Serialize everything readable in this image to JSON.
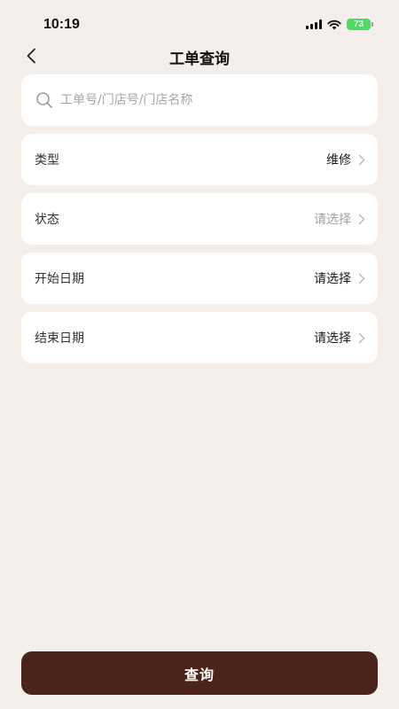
{
  "status_bar": {
    "time": "10:19",
    "battery": "73"
  },
  "header": {
    "title": "工单查询"
  },
  "search": {
    "placeholder": "工单号/门店号/门店名称"
  },
  "fields": [
    {
      "label": "类型",
      "value": "维修",
      "muted": false
    },
    {
      "label": "状态",
      "value": "请选择",
      "muted": true
    },
    {
      "label": "开始日期",
      "value": "请选择",
      "muted": false
    },
    {
      "label": "结束日期",
      "value": "请选择",
      "muted": false
    }
  ],
  "footer": {
    "query_label": "查询"
  },
  "colors": {
    "background": "#f4efea",
    "primary_button": "#4a231b",
    "battery": "#4cd964"
  },
  "icons": [
    "back-chevron-icon",
    "search-icon",
    "chevron-right-icon",
    "signal-icon",
    "wifi-icon",
    "battery-icon"
  ]
}
